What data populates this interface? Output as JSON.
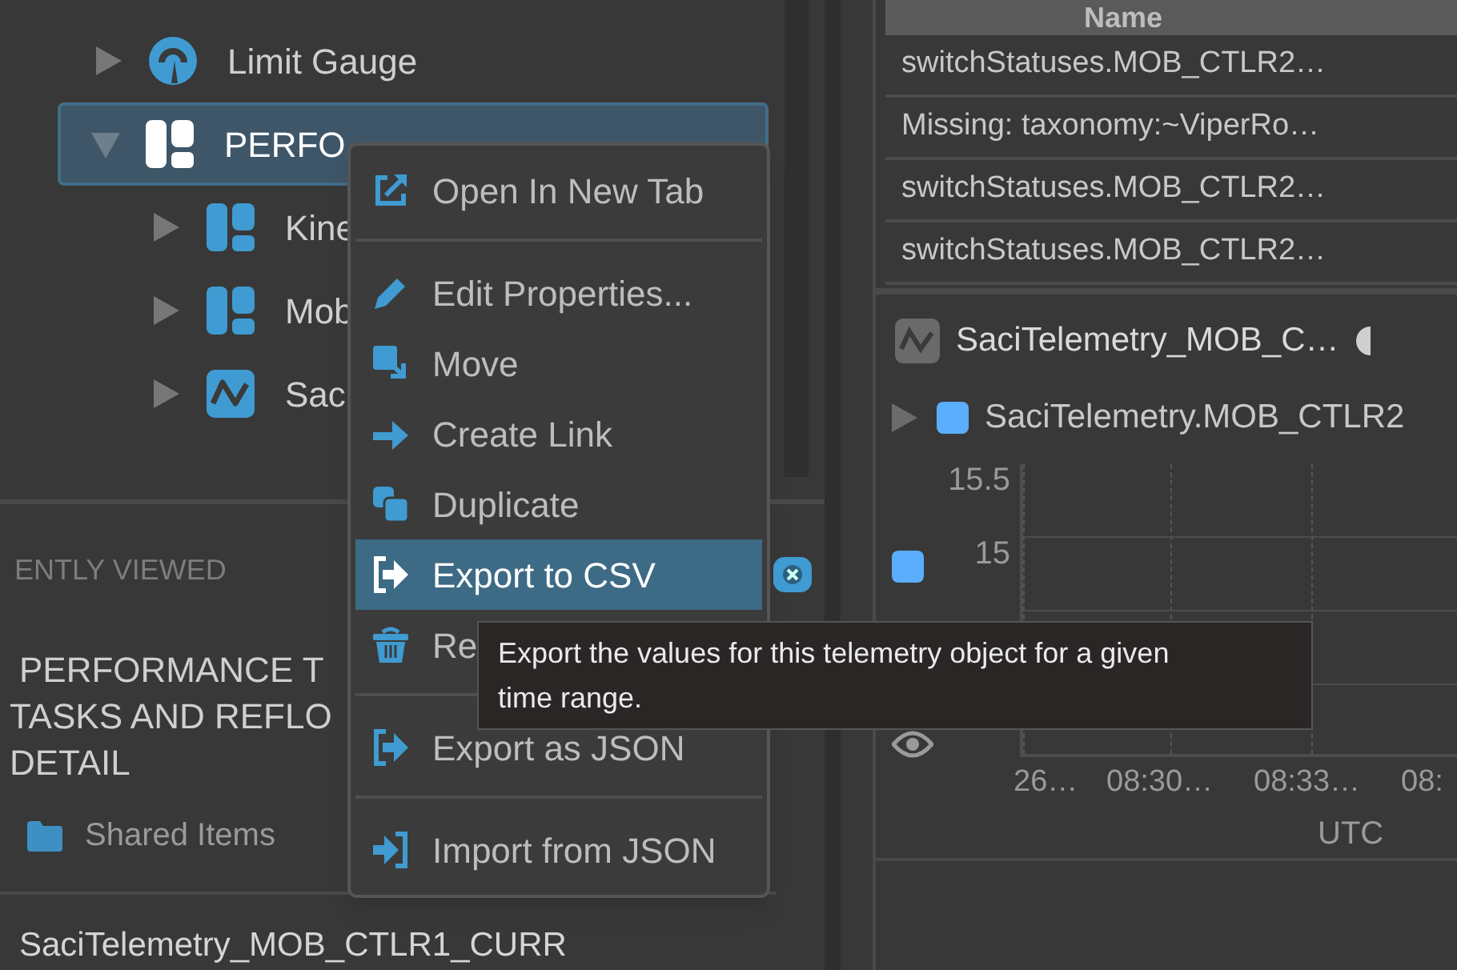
{
  "tree": [
    {
      "label": "Limit Gauge",
      "kind": "gauge",
      "expanded": false,
      "selected": false
    },
    {
      "label": "PERFO",
      "kind": "layout",
      "expanded": true,
      "selected": true,
      "children": [
        {
          "label": "Kine",
          "kind": "layout",
          "expanded": false,
          "selected": false
        },
        {
          "label": "Mob",
          "kind": "layout",
          "expanded": false,
          "selected": false
        },
        {
          "label": "Sac",
          "kind": "telemetry",
          "expanded": false,
          "selected": false
        }
      ]
    }
  ],
  "recently_viewed": {
    "heading": "ENTLY VIEWED",
    "item_lines": [
      "PERFORMANCE T",
      "TASKS AND REFLO",
      "DETAIL"
    ],
    "path": "Shared Items",
    "current": "SaciTelemetry_MOB_CTLR1_CURR"
  },
  "table": {
    "columns": [
      "Name"
    ],
    "rows": [
      "switchStatuses.MOB_CTLR2…",
      "Missing: taxonomy:~ViperRo…",
      "switchStatuses.MOB_CTLR2…",
      "switchStatuses.MOB_CTLR2…"
    ]
  },
  "plot": {
    "title": "SaciTelemetry_MOB_C…",
    "legend": {
      "label": "SaciTelemetry.MOB_CTLR2",
      "color": "#5aaefc"
    },
    "yticks": [
      "15.5",
      "15"
    ],
    "xticks": [
      "26…",
      "08:30…",
      "08:33…",
      "08:"
    ],
    "xlabel": "UTC"
  },
  "menu": {
    "groups": [
      [
        {
          "label": "Open In New Tab",
          "kind": "open",
          "selected": false
        }
      ],
      [
        {
          "label": "Edit Properties...",
          "kind": "pencil",
          "selected": false
        },
        {
          "label": "Move",
          "kind": "move",
          "selected": false
        },
        {
          "label": "Create Link",
          "kind": "link",
          "selected": false
        },
        {
          "label": "Duplicate",
          "kind": "duplicate",
          "selected": false
        },
        {
          "label": "Export to CSV",
          "kind": "export",
          "selected": true
        },
        {
          "label": "Re",
          "kind": "trash",
          "selected": false
        }
      ],
      [
        {
          "label": "Export as JSON",
          "kind": "export",
          "selected": false
        }
      ],
      [
        {
          "label": "Import from JSON",
          "kind": "import",
          "selected": false
        }
      ]
    ]
  },
  "tooltip": "Export the values for this telemetry object for a given time range."
}
